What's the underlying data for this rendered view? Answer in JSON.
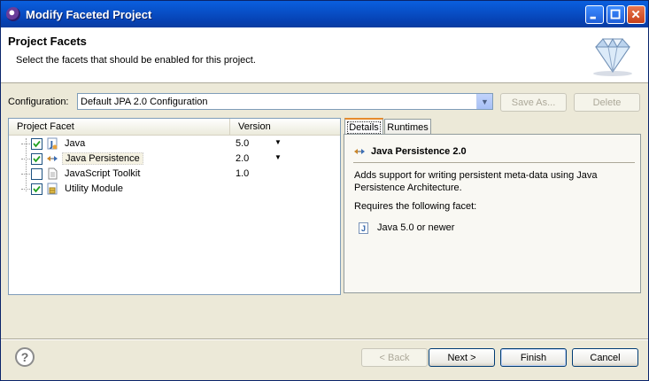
{
  "window": {
    "title": "Modify Faceted Project"
  },
  "header": {
    "title": "Project Facets",
    "description": "Select the facets that should be enabled for this project."
  },
  "configuration": {
    "label": "Configuration:",
    "value": "Default JPA 2.0 Configuration",
    "save_as_label": "Save As...",
    "delete_label": "Delete"
  },
  "facets": {
    "column_facet": "Project Facet",
    "column_version": "Version",
    "rows": [
      {
        "label": "Java",
        "version": "5.0",
        "checked": true,
        "icon": "java-icon"
      },
      {
        "label": "Java Persistence",
        "version": "2.0",
        "checked": true,
        "icon": "jpa-icon"
      },
      {
        "label": "JavaScript Toolkit",
        "version": "1.0",
        "checked": false,
        "icon": "document-icon"
      },
      {
        "label": "Utility Module",
        "version": "",
        "checked": true,
        "icon": "module-icon"
      }
    ]
  },
  "tabs": {
    "details": "Details",
    "runtimes": "Runtimes"
  },
  "details": {
    "title": "Java Persistence 2.0",
    "description": "Adds support for writing persistent meta-data using Java Persistence Architecture.",
    "requires_label": "Requires the following facet:",
    "requirement": "Java 5.0 or newer"
  },
  "buttons": {
    "back": "< Back",
    "next": "Next >",
    "finish": "Finish",
    "cancel": "Cancel"
  },
  "colors": {
    "titlebar": "#0a5fde",
    "accent_tab": "#e68b2c"
  }
}
